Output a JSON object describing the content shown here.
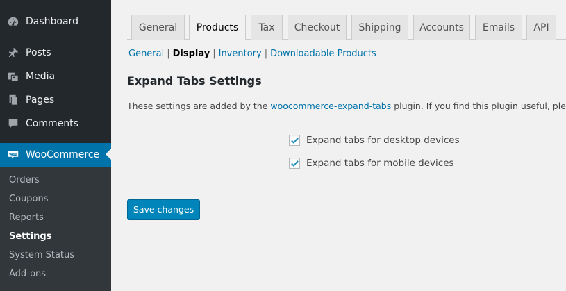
{
  "sidebar": {
    "items": [
      {
        "label": "Dashboard",
        "icon": "dashboard-icon"
      },
      {
        "label": "Posts",
        "icon": "pin-icon"
      },
      {
        "label": "Media",
        "icon": "media-icon"
      },
      {
        "label": "Pages",
        "icon": "pages-icon"
      },
      {
        "label": "Comments",
        "icon": "comment-icon"
      },
      {
        "label": "WooCommerce",
        "icon": "woo-icon",
        "active": true
      }
    ],
    "submenu": [
      {
        "label": "Orders"
      },
      {
        "label": "Coupons"
      },
      {
        "label": "Reports"
      },
      {
        "label": "Settings",
        "current": true
      },
      {
        "label": "System Status"
      },
      {
        "label": "Add-ons"
      }
    ]
  },
  "tabs": [
    {
      "label": "General"
    },
    {
      "label": "Products",
      "active": true
    },
    {
      "label": "Tax"
    },
    {
      "label": "Checkout"
    },
    {
      "label": "Shipping"
    },
    {
      "label": "Accounts"
    },
    {
      "label": "Emails"
    },
    {
      "label": "API"
    }
  ],
  "subnav": {
    "general": "General",
    "display": "Display",
    "inventory": "Inventory",
    "downloadable": "Downloadable Products",
    "separator": "|"
  },
  "section": {
    "title": "Expand Tabs Settings",
    "desc_before": "These settings are added by the ",
    "desc_link": "woocommerce-expand-tabs",
    "desc_after": " plugin. If you find this plugin useful, please s"
  },
  "options": [
    {
      "label": "Expand tabs for desktop devices",
      "checked": true
    },
    {
      "label": "Expand tabs for mobile devices",
      "checked": true
    }
  ],
  "save_button": "Save changes",
  "colors": {
    "admin_bar": "#23282d",
    "submenu_bg": "#32373c",
    "accent": "#0073aa",
    "button": "#0085ba"
  }
}
